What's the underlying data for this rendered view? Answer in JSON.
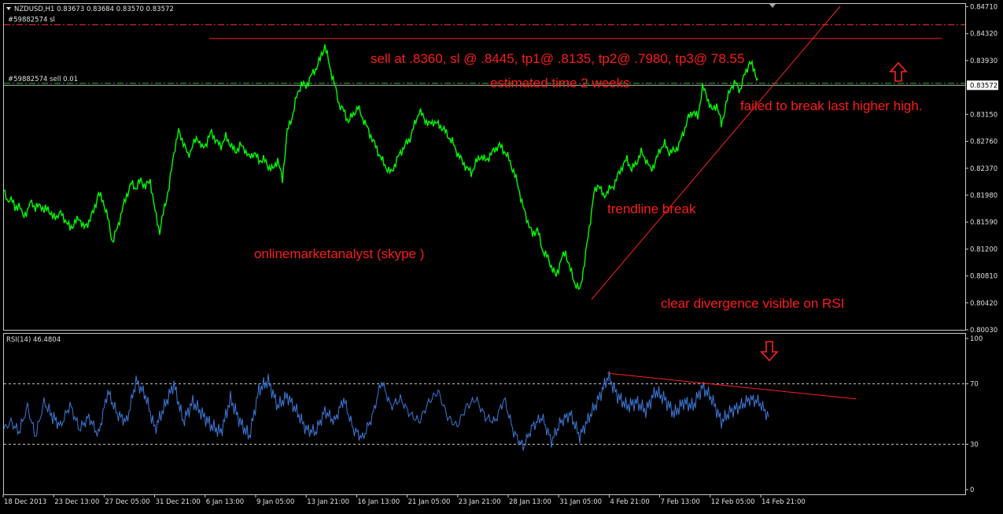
{
  "header": {
    "symbol_line": "NZDUSD,H1  0.83673 0.83684 0.83570 0.83572",
    "rsi_line": "RSI(14) 46.4804"
  },
  "order_labels": {
    "sl": "#59882574 sl",
    "sell": "#59882574 sell 0.01"
  },
  "annotations": {
    "trade_plan": "sell at .8360, sl @ .8445,  tp1@ .8135,  tp2@ .7980, tp3@ 78.55",
    "estimated_time": "estimated time 2 weeks",
    "failed_break": "failed to break last higher high.",
    "trendline_break": "trendline break",
    "contact": "onlinemarketanalyst (skype )",
    "divergence": "clear divergence visible on RSI"
  },
  "colors": {
    "background": "#000000",
    "price": "#00ff00",
    "rsi": "#3d78d8",
    "annotation": "#ff1a1a",
    "grid": "#c8c8c8"
  },
  "chart_data": [
    {
      "type": "line",
      "name": "price",
      "ylim": [
        0.8003,
        0.8475
      ],
      "y_ticks": [
        "0.84710",
        "0.84320",
        "0.83930",
        "0.83572",
        "0.83150",
        "0.82760",
        "0.82370",
        "0.81980",
        "0.81590",
        "0.81200",
        "0.80810",
        "0.80420",
        "0.80030"
      ],
      "y_tick_values": [
        0.8471,
        0.8432,
        0.8393,
        0.8357,
        0.8315,
        0.8276,
        0.8237,
        0.8198,
        0.8159,
        0.812,
        0.8081,
        0.8042,
        0.8003
      ],
      "current_price": 0.83572,
      "levels": {
        "sl": 0.8445,
        "sell": 0.836
      },
      "x_ticks": [
        "18 Dec 2013",
        "23 Dec 13:00",
        "27 Dec 05:00",
        "31 Dec 21:00",
        "6 Jan 13:00",
        "9 Jan 05:00",
        "13 Jan 21:00",
        "16 Jan 13:00",
        "21 Jan 05:00",
        "23 Jan 21:00",
        "28 Jan 13:00",
        "31 Jan 05:00",
        "4 Feb 21:00",
        "7 Feb 13:00",
        "12 Feb 05:00",
        "14 Feb 21:00"
      ],
      "x": [
        0,
        4,
        9,
        14,
        19,
        24,
        30,
        35,
        40,
        46,
        51,
        56,
        62,
        67,
        72,
        78,
        84,
        90,
        96,
        102,
        108,
        114,
        120,
        126,
        132,
        138,
        144,
        150,
        156,
        162,
        168,
        174,
        180,
        186,
        192,
        198,
        204,
        210,
        216,
        222,
        228,
        234,
        240,
        246,
        252,
        258,
        264,
        270,
        276,
        282,
        288,
        294,
        300,
        306,
        312,
        318,
        324,
        330,
        336,
        342,
        348,
        354,
        360,
        366,
        372,
        378,
        384,
        390,
        396,
        402,
        408,
        414,
        420,
        426,
        432,
        438,
        444,
        450,
        456,
        462,
        468,
        474,
        480,
        486,
        492,
        498,
        504,
        510,
        516,
        522,
        528,
        534,
        540,
        546,
        552,
        558,
        564,
        570,
        576,
        582,
        588,
        594,
        600,
        606,
        612,
        618,
        624,
        630,
        636,
        642,
        648,
        654,
        660,
        666,
        672,
        678,
        684,
        690,
        696,
        702,
        708,
        714,
        720,
        726,
        732,
        738,
        744,
        750,
        756,
        762,
        768,
        774,
        780,
        786,
        792,
        798,
        804,
        810,
        816,
        822,
        828,
        834,
        840,
        846,
        852,
        858,
        864,
        870,
        876,
        882,
        888,
        894,
        900,
        906,
        912,
        918,
        924,
        930,
        936,
        942,
        948,
        954,
        960,
        966,
        972
      ],
      "values": [
        0.8205,
        0.8188,
        0.8195,
        0.8178,
        0.8185,
        0.8168,
        0.8175,
        0.819,
        0.8178,
        0.8185,
        0.8175,
        0.818,
        0.8165,
        0.8168,
        0.8172,
        0.8162,
        0.815,
        0.8158,
        0.8165,
        0.815,
        0.816,
        0.8175,
        0.82,
        0.819,
        0.8165,
        0.813,
        0.815,
        0.8175,
        0.8198,
        0.8215,
        0.8208,
        0.822,
        0.821,
        0.822,
        0.8175,
        0.8145,
        0.818,
        0.821,
        0.826,
        0.829,
        0.8275,
        0.8255,
        0.827,
        0.8282,
        0.8265,
        0.8275,
        0.829,
        0.8275,
        0.827,
        0.8282,
        0.8272,
        0.826,
        0.827,
        0.8265,
        0.8252,
        0.826,
        0.8248,
        0.825,
        0.824,
        0.8235,
        0.825,
        0.822,
        0.829,
        0.831,
        0.834,
        0.836,
        0.8355,
        0.837,
        0.838,
        0.8395,
        0.8415,
        0.8385,
        0.836,
        0.833,
        0.832,
        0.8305,
        0.8315,
        0.8325,
        0.831,
        0.8295,
        0.828,
        0.8265,
        0.825,
        0.8238,
        0.823,
        0.8245,
        0.826,
        0.827,
        0.828,
        0.83,
        0.832,
        0.831,
        0.83,
        0.8305,
        0.83,
        0.8295,
        0.8285,
        0.8275,
        0.826,
        0.8248,
        0.8238,
        0.823,
        0.8245,
        0.8255,
        0.8248,
        0.8255,
        0.8265,
        0.827,
        0.8262,
        0.825,
        0.8232,
        0.821,
        0.818,
        0.816,
        0.814,
        0.815,
        0.812,
        0.811,
        0.8095,
        0.808,
        0.8105,
        0.8115,
        0.809,
        0.807,
        0.806,
        0.81,
        0.815,
        0.82,
        0.8215,
        0.8195,
        0.8205,
        0.821,
        0.8225,
        0.824,
        0.825,
        0.8235,
        0.8245,
        0.826,
        0.825,
        0.8235,
        0.8245,
        0.8265,
        0.8272,
        0.826,
        0.8262,
        0.827,
        0.829,
        0.831,
        0.832,
        0.831,
        0.8355,
        0.834,
        0.832,
        0.833,
        0.83,
        0.833,
        0.8355,
        0.836,
        0.835,
        0.8375,
        0.839,
        0.838,
        0.8355
      ]
    },
    {
      "type": "line",
      "name": "RSI(14)",
      "ylim": [
        0,
        100
      ],
      "y_ticks": [
        "100",
        "70",
        "30",
        "0"
      ],
      "y_tick_values": [
        100,
        70,
        30,
        0
      ],
      "levels": [
        70,
        30
      ],
      "x": [
        0,
        9,
        19,
        30,
        40,
        51,
        62,
        72,
        84,
        96,
        108,
        120,
        132,
        144,
        156,
        168,
        180,
        192,
        204,
        216,
        228,
        240,
        252,
        264,
        276,
        288,
        300,
        312,
        324,
        336,
        348,
        360,
        372,
        384,
        396,
        408,
        420,
        432,
        444,
        456,
        468,
        480,
        492,
        504,
        516,
        528,
        540,
        552,
        564,
        576,
        588,
        600,
        612,
        624,
        636,
        648,
        660,
        672,
        684,
        696,
        708,
        720,
        732,
        744,
        756,
        768,
        780,
        792,
        804,
        816,
        828,
        840,
        852,
        864,
        876,
        888,
        900,
        912,
        924,
        936,
        948,
        960,
        972
      ],
      "values": [
        40,
        45,
        38,
        55,
        35,
        58,
        48,
        42,
        56,
        40,
        48,
        36,
        65,
        50,
        45,
        72,
        62,
        40,
        55,
        70,
        45,
        58,
        50,
        42,
        38,
        60,
        45,
        35,
        66,
        72,
        55,
        62,
        52,
        40,
        38,
        52,
        45,
        60,
        40,
        34,
        48,
        72,
        55,
        60,
        50,
        45,
        58,
        65,
        48,
        42,
        55,
        60,
        48,
        45,
        60,
        38,
        28,
        42,
        48,
        32,
        45,
        50,
        35,
        48,
        60,
        75,
        62,
        55,
        58,
        52,
        65,
        60,
        50,
        58,
        55,
        68,
        60,
        45,
        52,
        55,
        60,
        58,
        48
      ]
    },
    {
      "type": "line",
      "name": "trendlines",
      "price_trendline": {
        "x": [
          752,
          1068
        ],
        "y": [
          0.8047,
          0.848
        ]
      },
      "rsi_trendline": {
        "x": [
          772,
          1088
        ],
        "y": [
          77,
          60
        ]
      },
      "resistance_line": {
        "x": [
          266,
          1197
        ],
        "y": [
          0.8425,
          0.8425
        ]
      }
    }
  ]
}
